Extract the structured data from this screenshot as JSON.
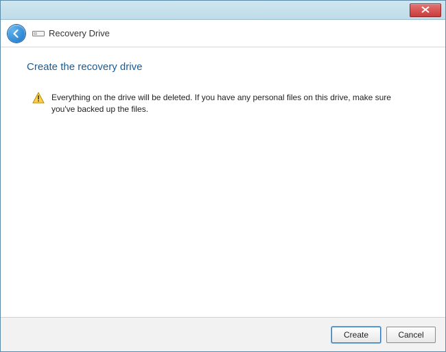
{
  "header": {
    "title": "Recovery Drive"
  },
  "page": {
    "title": "Create the recovery drive",
    "warning_message": "Everything on the drive will be deleted. If you have any personal files on this drive, make sure you've backed up the files."
  },
  "footer": {
    "primary_label": "Create",
    "secondary_label": "Cancel"
  }
}
